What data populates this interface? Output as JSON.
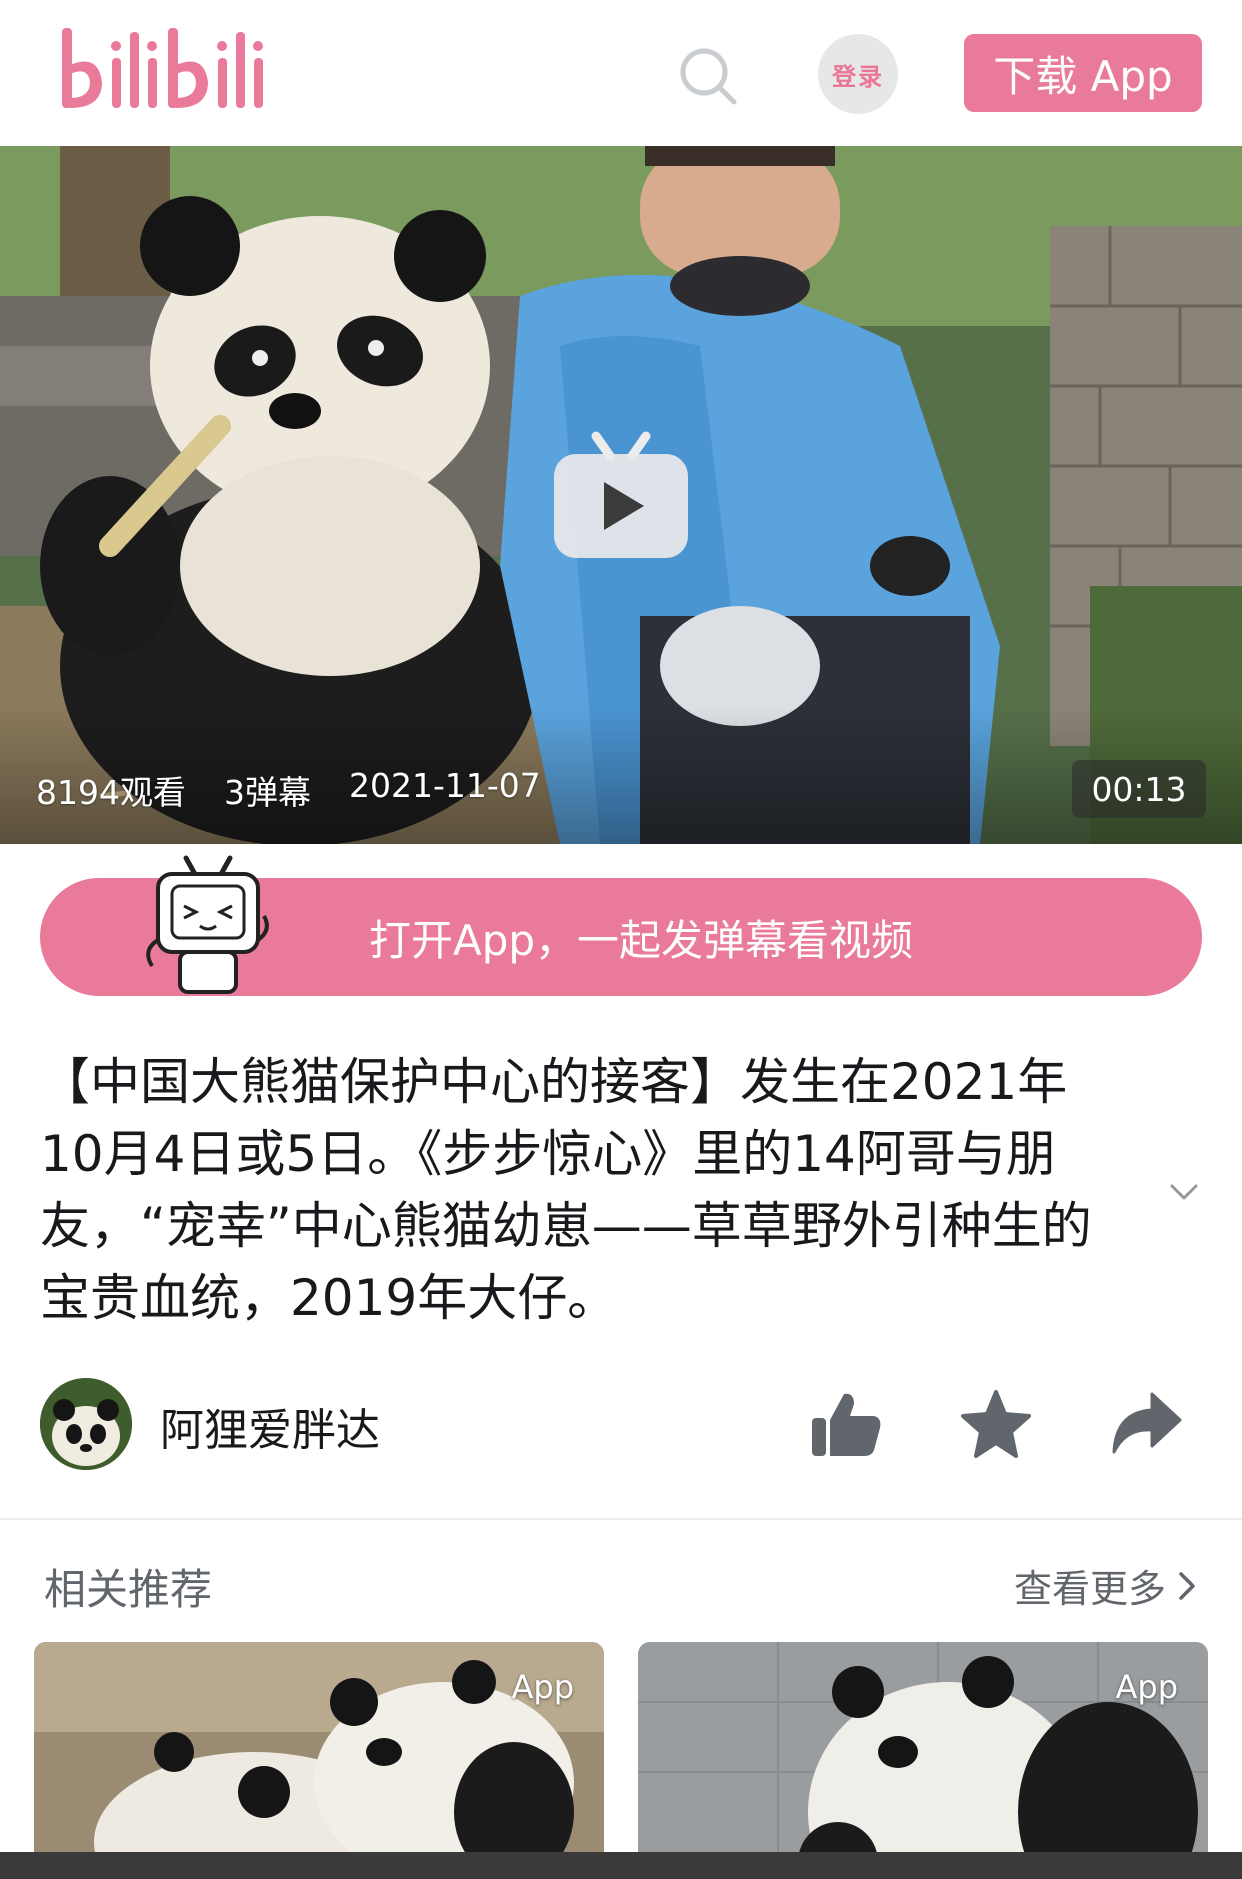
{
  "header": {
    "logo_text": "bilibili",
    "search_icon": "search-icon",
    "login_label": "登录",
    "download_label": "下载 App"
  },
  "video": {
    "views": "8194观看",
    "danmaku": "3弹幕",
    "date": "2021-11-07",
    "duration": "00:13",
    "play_icon": "tv-play-icon"
  },
  "open_app_banner": "打开App，一起发弹幕看视频",
  "title": "【中国大熊猫保护中心的接客】发生在2021年10月4日或5日。《步步惊心》里的14阿哥与朋友，“宠幸”中心熊猫幼崽——草草野外引种生的宝贵血统，2019年大仔。",
  "author": {
    "name": "阿狸爱胖达"
  },
  "actions": {
    "like_icon": "thumbs-up-icon",
    "favorite_icon": "star-icon",
    "share_icon": "share-icon"
  },
  "related": {
    "title": "相关推荐",
    "more_label": "查看更多",
    "cards": [
      {
        "tag": "App"
      },
      {
        "tag": "App"
      }
    ]
  },
  "colors": {
    "brand_pink": "#ea7a99",
    "text": "#18191c",
    "secondary_text": "#61666d"
  }
}
